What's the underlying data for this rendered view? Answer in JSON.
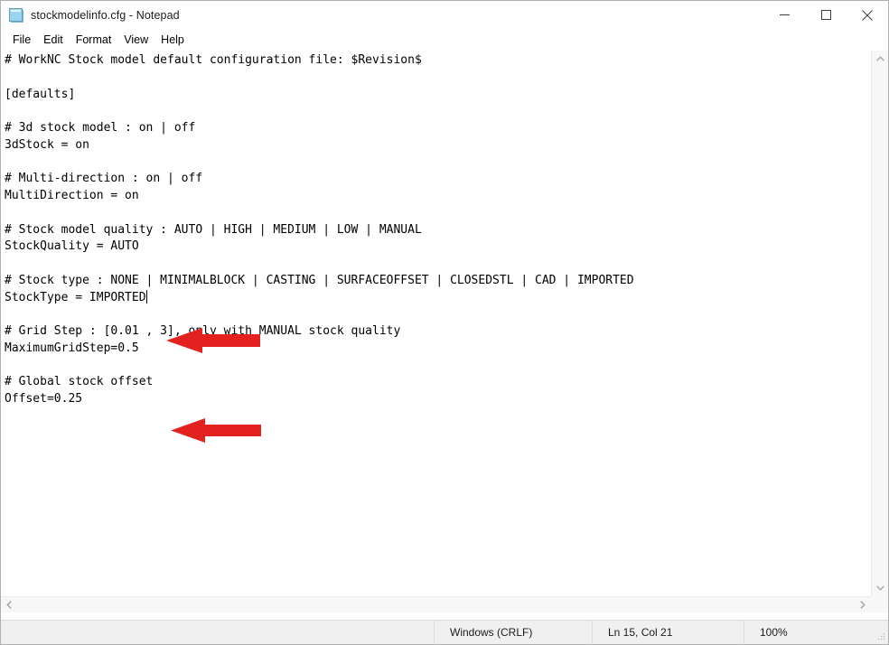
{
  "window": {
    "title": "stockmodelinfo.cfg - Notepad",
    "icon": "notepad-icon",
    "controls": {
      "minimize": "Minimize",
      "maximize": "Maximize",
      "close": "Close"
    }
  },
  "menu": {
    "items": [
      {
        "label": "File"
      },
      {
        "label": "Edit"
      },
      {
        "label": "Format"
      },
      {
        "label": "View"
      },
      {
        "label": "Help"
      }
    ]
  },
  "editor": {
    "content": "# WorkNC Stock model default configuration file: $Revision$\n\n[defaults]\n\n# 3d stock model : on | off\n3dStock = on\n\n# Multi-direction : on | off\nMultiDirection = on\n\n# Stock model quality : AUTO | HIGH | MEDIUM | LOW | MANUAL\nStockQuality = AUTO\n\n# Stock type : NONE | MINIMALBLOCK | CASTING | SURFACEOFFSET | CLOSEDSTL | CAD | IMPORTED\nStockType = IMPORTED",
    "content_after_caret": "\n\n# Grid Step : [0.01 , 3], only with MANUAL stock quality\nMaximumGridStep=0.5\n\n# Global stock offset\nOffset=0.25",
    "lines": [
      "# WorkNC Stock model default configuration file: $Revision$",
      "",
      "[defaults]",
      "",
      "# 3d stock model : on | off",
      "3dStock = on",
      "",
      "# Multi-direction : on | off",
      "MultiDirection = on",
      "",
      "# Stock model quality : AUTO | HIGH | MEDIUM | LOW | MANUAL",
      "StockQuality = AUTO",
      "",
      "# Stock type : NONE | MINIMALBLOCK | CASTING | SURFACEOFFSET | CLOSEDSTL | CAD | IMPORTED",
      "StockType = IMPORTED",
      "",
      "# Grid Step : [0.01 , 3], only with MANUAL stock quality",
      "MaximumGridStep=0.5",
      "",
      "# Global stock offset",
      "Offset=0.25"
    ]
  },
  "annotations": {
    "color": "#e3221f",
    "arrows": [
      {
        "name": "arrow-stocktype",
        "points_to": "StockType = IMPORTED"
      },
      {
        "name": "arrow-global-stock-offset",
        "points_to": "# Global stock offset"
      }
    ]
  },
  "scrollbars": {
    "vertical": {
      "up_icon": "chevron-up-icon",
      "down_icon": "chevron-down-icon"
    },
    "horizontal": {
      "left_icon": "chevron-left-icon",
      "right_icon": "chevron-right-icon"
    }
  },
  "statusbar": {
    "encoding": "Windows (CRLF)",
    "position": "Ln 15, Col 21",
    "zoom": "100%"
  }
}
